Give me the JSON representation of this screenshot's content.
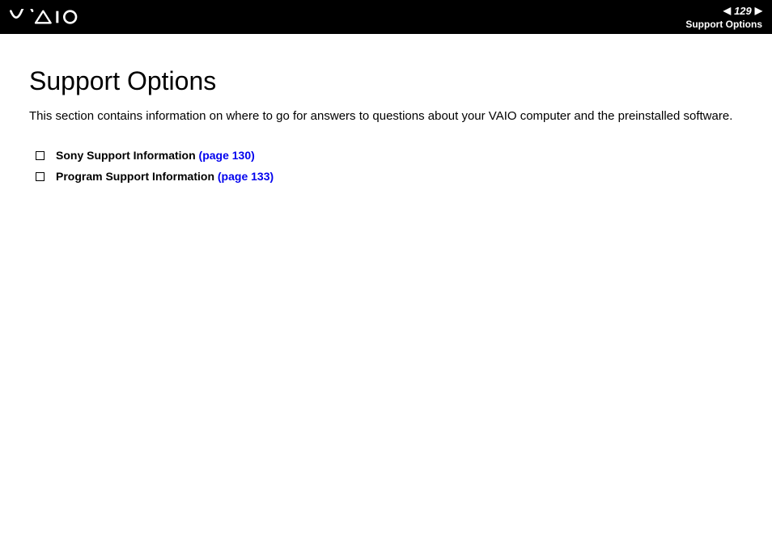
{
  "header": {
    "page_number": "129",
    "section_label": "Support Options"
  },
  "content": {
    "title": "Support Options",
    "intro": "This section contains information on where to go for answers to questions about your VAIO computer and the preinstalled software.",
    "links": [
      {
        "label": "Sony Support Information",
        "page_ref": "(page 130)"
      },
      {
        "label": "Program Support Information",
        "page_ref": "(page 133)"
      }
    ]
  }
}
